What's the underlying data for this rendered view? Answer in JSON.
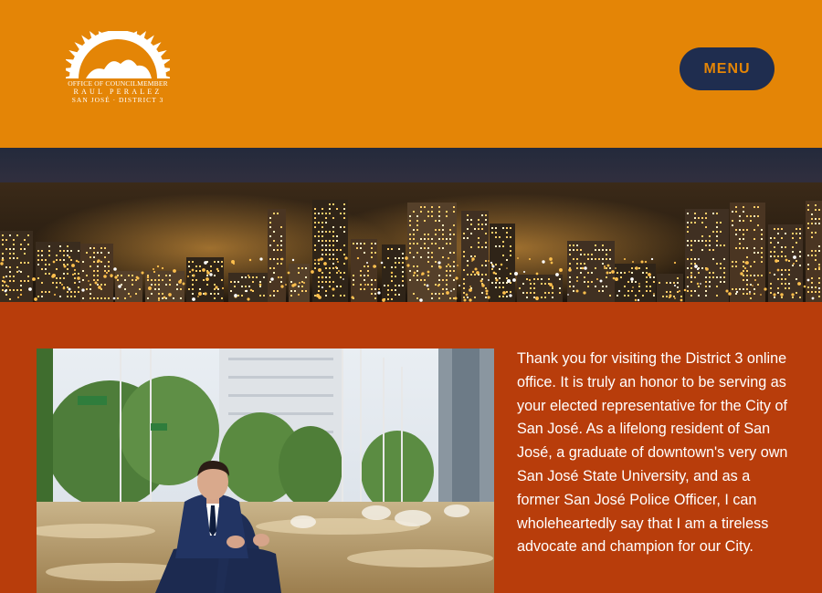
{
  "header": {
    "logo": {
      "line1": "OFFICE OF COUNCILMEMBER",
      "line2": "RAUL PERALEZ",
      "line3": "SAN JOSÉ · DISTRICT 3",
      "icon": "sun-icon"
    },
    "menu_label": "MENU"
  },
  "banner": {
    "alt": "San José downtown skyline at night",
    "icon": "city-skyline-image"
  },
  "main": {
    "photo_alt": "Councilmember seated at a downtown fountain plaza",
    "intro_text": "Thank you for visiting the District 3 online office. It is truly an honor to be serving as your elected representative for the City of San José. As a lifelong resident of San José, a graduate of downtown's very own San José State University, and as a former San José Police Officer, I can wholeheartedly say that I am a tireless advocate and champion for our City."
  },
  "colors": {
    "header_bg": "#e48506",
    "content_bg": "#b83d0b",
    "menu_bg": "#1f2d4f",
    "menu_text": "#e48506"
  }
}
